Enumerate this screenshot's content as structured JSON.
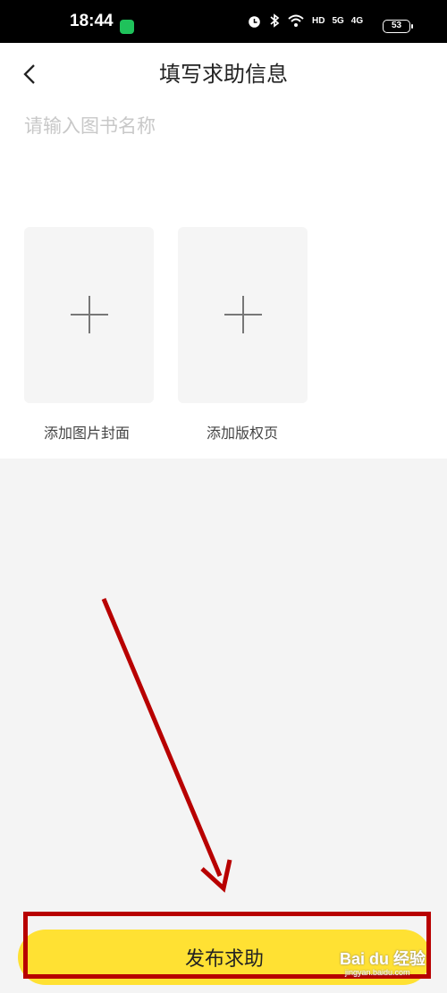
{
  "status_bar": {
    "time": "18:44",
    "network_hd": "HD",
    "signal1": "5G",
    "signal2": "4G",
    "battery": "53"
  },
  "header": {
    "title": "填写求助信息"
  },
  "form": {
    "book_name_placeholder": "请输入图书名称",
    "book_name_value": "",
    "upload_cover_label": "添加图片封面",
    "upload_copyright_label": "添加版权页"
  },
  "actions": {
    "submit_label": "发布求助"
  },
  "watermark": {
    "brand": "Bai du 经验",
    "url": "jingyan.baidu.com"
  },
  "colors": {
    "accent": "#ffe133",
    "annotation": "#b80000"
  },
  "icons": [
    "back-icon",
    "plus-icon",
    "alarm-icon",
    "bluetooth-icon",
    "wifi-icon"
  ]
}
